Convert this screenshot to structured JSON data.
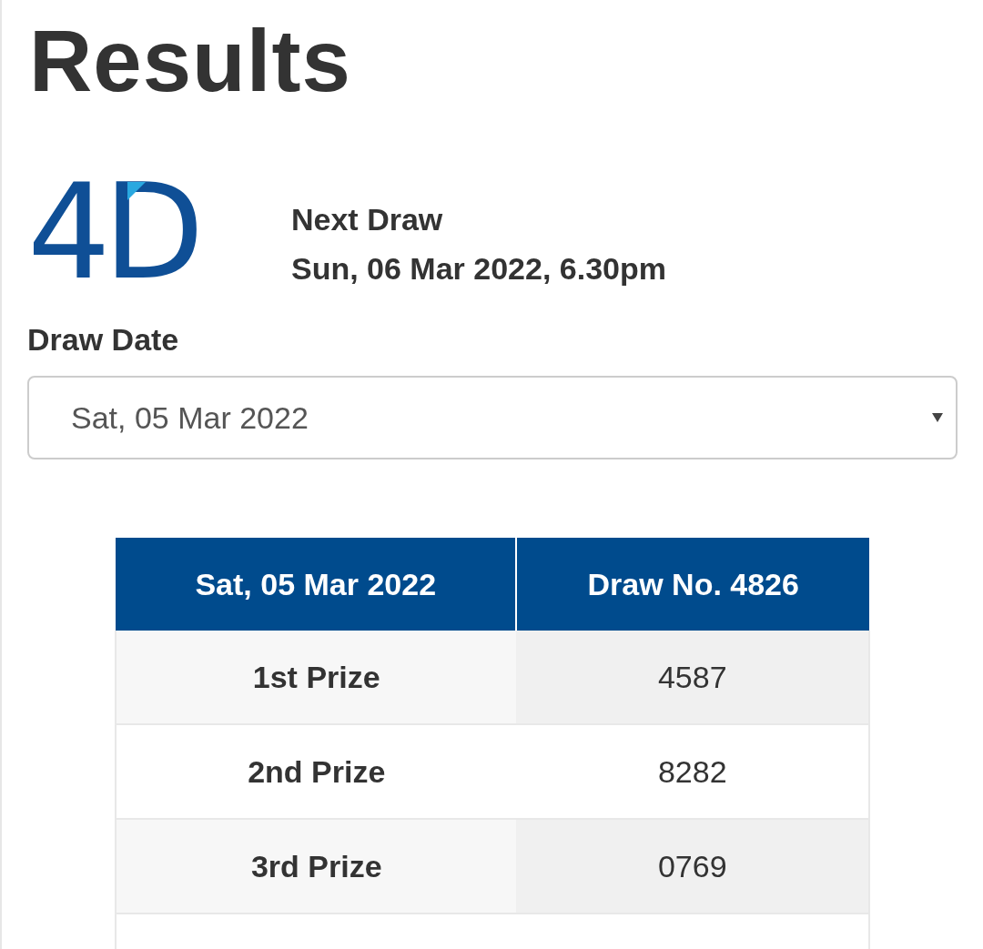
{
  "page_title": "Results",
  "logo": {
    "text": "4D"
  },
  "next_draw": {
    "label": "Next Draw",
    "datetime": "Sun, 06 Mar 2022, 6.30pm"
  },
  "draw_date": {
    "label": "Draw Date",
    "value": "Sat, 05 Mar 2022"
  },
  "table": {
    "columns": [
      "Sat, 05 Mar 2022",
      "Draw No. 4826"
    ],
    "rows": [
      {
        "prize": "1st Prize",
        "number": "4587"
      },
      {
        "prize": "2nd Prize",
        "number": "8282"
      },
      {
        "prize": "3rd Prize",
        "number": "0769"
      }
    ]
  }
}
